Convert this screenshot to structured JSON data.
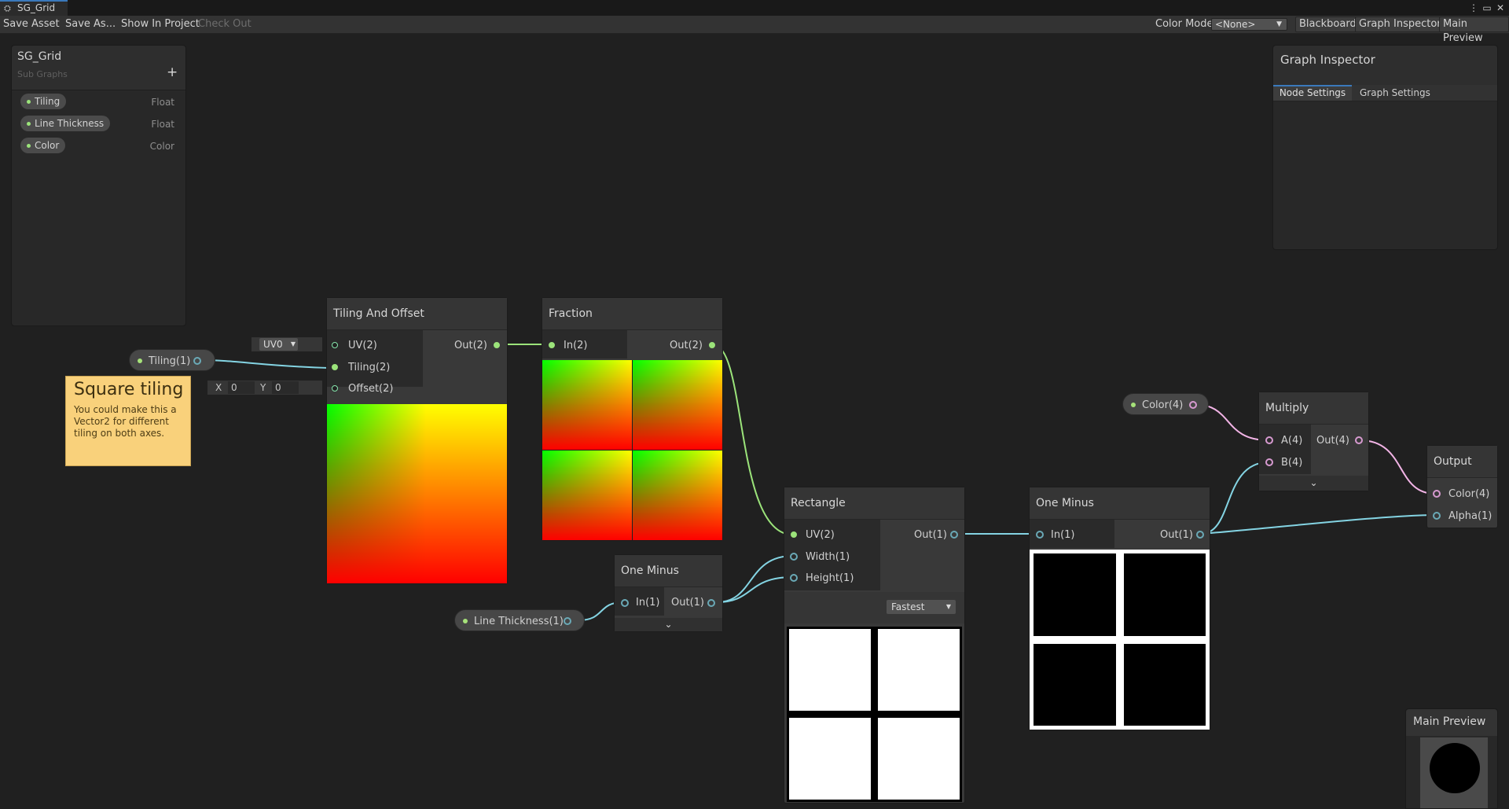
{
  "window": {
    "tab_title": "SG_Grid"
  },
  "toolbar": {
    "save_asset": "Save Asset",
    "save_as": "Save As...",
    "show_in_project": "Show In Project",
    "check_out": "Check Out",
    "color_mode_label": "Color Mode",
    "color_mode_value": "<None>",
    "blackboard": "Blackboard",
    "graph_inspector": "Graph Inspector",
    "main_preview": "Main Preview"
  },
  "blackboard": {
    "title": "SG_Grid",
    "subtitle": "Sub Graphs",
    "add_symbol": "+",
    "properties": [
      {
        "name": "Tiling",
        "type": "Float"
      },
      {
        "name": "Line Thickness",
        "type": "Float"
      },
      {
        "name": "Color",
        "type": "Color"
      }
    ]
  },
  "inspector": {
    "title": "Graph Inspector",
    "tabs": [
      "Node Settings",
      "Graph Settings"
    ],
    "active_tab": "Node Settings"
  },
  "sticky_note": {
    "title": "Square tiling",
    "body": "You could make this a Vector2 for different tiling on both axes."
  },
  "property_nodes": {
    "tiling": "Tiling(1)",
    "line_thickness": "Line Thickness(1)",
    "color": "Color(4)"
  },
  "inline_inputs": {
    "uv_channel": "UV0",
    "offset_x_label": "X",
    "offset_x": "0",
    "offset_y_label": "Y",
    "offset_y": "0"
  },
  "nodes": {
    "tiling_offset": {
      "title": "Tiling And Offset",
      "inputs": [
        "UV(2)",
        "Tiling(2)",
        "Offset(2)"
      ],
      "output": "Out(2)"
    },
    "fraction": {
      "title": "Fraction",
      "input": "In(2)",
      "output": "Out(2)"
    },
    "one_minus_small": {
      "title": "One Minus",
      "input": "In(1)",
      "output": "Out(1)"
    },
    "rectangle": {
      "title": "Rectangle",
      "inputs": [
        "UV(2)",
        "Width(1)",
        "Height(1)"
      ],
      "output": "Out(1)",
      "mode": "Fastest"
    },
    "one_minus_big": {
      "title": "One Minus",
      "input": "In(1)",
      "output": "Out(1)"
    },
    "multiply": {
      "title": "Multiply",
      "inputs": [
        "A(4)",
        "B(4)"
      ],
      "output": "Out(4)"
    },
    "output": {
      "title": "Output",
      "inputs": [
        "Color(4)",
        "Alpha(1)"
      ]
    }
  },
  "main_preview": {
    "title": "Main Preview"
  },
  "colors": {
    "float_port": "#84d4e3",
    "vector2_port": "#9be37a",
    "vector4_port": "#f2b4e6",
    "sticky_note": "#f9d17b",
    "tab_accent": "#3a79bb"
  }
}
